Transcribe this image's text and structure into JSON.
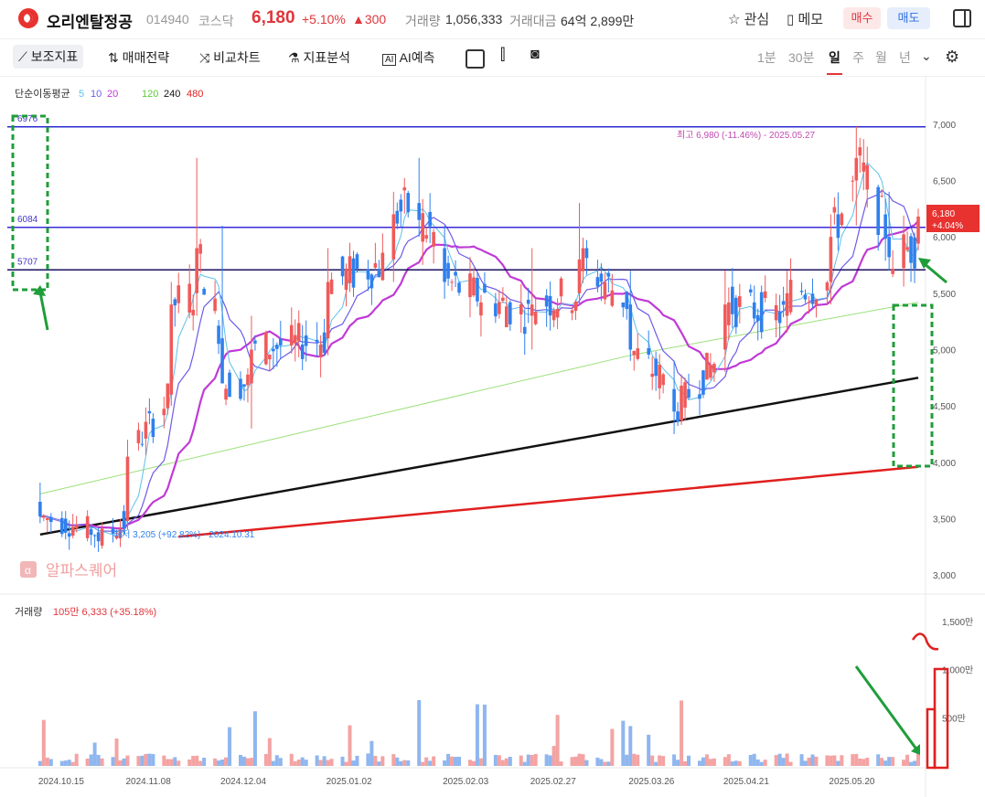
{
  "header": {
    "name": "오리엔탈정공",
    "code": "014940",
    "market": "코스닥",
    "price": "6,180",
    "change_pct": "+5.10%",
    "change_abs": "▲300",
    "volume_label": "거래량",
    "volume": "1,056,333",
    "amount_label": "거래대금",
    "amount": "64억 2,899만",
    "watch_label": "관심",
    "memo_label": "메모",
    "buy_label": "매수",
    "sell_label": "매도"
  },
  "toolbar": {
    "items": [
      "보조지표",
      "매매전략",
      "비교차트",
      "지표분석",
      "AI예측"
    ],
    "periods": [
      "1분",
      "30분",
      "일",
      "주",
      "월",
      "년"
    ],
    "active_period": "일"
  },
  "indicator_legend": {
    "label": "단순이동평균",
    "ma": [
      {
        "v": "5",
        "color": "#5bc0eb"
      },
      {
        "v": "10",
        "color": "#6c5ce7"
      },
      {
        "v": "20",
        "color": "#c03ad6"
      },
      {
        "v": "120",
        "color": "#7ed957"
      },
      {
        "v": "240",
        "color": "#111111"
      },
      {
        "v": "480",
        "color": "#e0201f"
      }
    ]
  },
  "watermark": "알파스퀘어",
  "colors": {
    "up": "#f05a5a",
    "down": "#2f80ed",
    "vol_up": "#f4a3a3",
    "vol_down": "#8fb6ef",
    "annotation": "#1f9d3a"
  },
  "chart_data": {
    "type": "candlestick",
    "x_ticks": [
      "2024.10.15",
      "2024.11.08",
      "2024.12.04",
      "2025.01.02",
      "2025.02.03",
      "2025.02.27",
      "2025.03.26",
      "2025.04.21",
      "2025.05.20"
    ],
    "y_ticks": [
      "3,000",
      "3,500",
      "4,000",
      "4,500",
      "5,000",
      "5,500",
      "6,000",
      "6,500",
      "7,000"
    ],
    "ylim": [
      2880,
      7420
    ],
    "horizontal_lines": [
      {
        "label": "6976",
        "value": 6976,
        "color": "#2b2bd0"
      },
      {
        "label": "6084",
        "value": 6084,
        "color": "#3a2bd8"
      },
      {
        "label": "5707",
        "value": 5707,
        "color": "#1a1060"
      }
    ],
    "high_annotation": "최고 6,980 (-11.46%) - 2025.05.27",
    "low_annotation": "최저 3,205 (+92.82%) - 2024.10.31",
    "last_price": "6,180",
    "last_change": "+4.04%",
    "ohlc_anchors": [
      {
        "x": "2024.10.15",
        "o": 3650,
        "h": 3820,
        "l": 3460,
        "c": 3520
      },
      {
        "x": "2024.10.31",
        "o": 3380,
        "h": 3420,
        "l": 3205,
        "c": 3300
      },
      {
        "x": "2024.11.08",
        "o": 3480,
        "h": 4200,
        "l": 3400,
        "c": 4050
      },
      {
        "x": "2024.11.20",
        "o": 4600,
        "h": 5600,
        "l": 4500,
        "c": 5400
      },
      {
        "x": "2024.11.27",
        "o": 5500,
        "h": 6700,
        "l": 5300,
        "c": 5900
      },
      {
        "x": "2024.12.04",
        "o": 5100,
        "h": 6100,
        "l": 4900,
        "c": 4700
      },
      {
        "x": "2024.12.12",
        "o": 4700,
        "h": 5300,
        "l": 4300,
        "c": 5000
      },
      {
        "x": "2025.01.02",
        "o": 5100,
        "h": 5900,
        "l": 4950,
        "c": 5600
      },
      {
        "x": "2025.01.20",
        "o": 5800,
        "h": 6400,
        "l": 5600,
        "c": 6200
      },
      {
        "x": "2025.01.27",
        "o": 6300,
        "h": 6700,
        "l": 6000,
        "c": 6150
      },
      {
        "x": "2025.02.03",
        "o": 5900,
        "h": 6100,
        "l": 5450,
        "c": 5600
      },
      {
        "x": "2025.02.27",
        "o": 5300,
        "h": 5900,
        "l": 5000,
        "c": 5400
      },
      {
        "x": "2025.03.12",
        "o": 5500,
        "h": 6300,
        "l": 5400,
        "c": 5800
      },
      {
        "x": "2025.03.26",
        "o": 5400,
        "h": 5700,
        "l": 4900,
        "c": 5000
      },
      {
        "x": "2025.04.07",
        "o": 4650,
        "h": 4900,
        "l": 4250,
        "c": 4450
      },
      {
        "x": "2025.04.21",
        "o": 5000,
        "h": 5700,
        "l": 4800,
        "c": 5400
      },
      {
        "x": "2025.05.08",
        "o": 5300,
        "h": 5700,
        "l": 5150,
        "c": 5500
      },
      {
        "x": "2025.05.20",
        "o": 5600,
        "h": 6200,
        "l": 5400,
        "c": 6000
      },
      {
        "x": "2025.05.27",
        "o": 6500,
        "h": 6980,
        "l": 6100,
        "c": 6700
      },
      {
        "x": "2025.06.05",
        "o": 6000,
        "h": 6400,
        "l": 5700,
        "c": 5820
      },
      {
        "x": "2025.06.13",
        "o": 5940,
        "h": 6250,
        "l": 5880,
        "c": 6180
      }
    ],
    "moving_averages": {
      "ma240": [
        {
          "x": "2024.10.15",
          "y": 3360
        },
        {
          "x": "2025.06.13",
          "y": 4750
        }
      ],
      "ma480": [
        {
          "x": "2024.11.22",
          "y": 3340
        },
        {
          "x": "2025.06.13",
          "y": 3960
        }
      ],
      "ma120": [
        {
          "x": "2024.10.15",
          "y": 3720
        },
        {
          "x": "2025.01.02",
          "y": 4320
        },
        {
          "x": "2025.03.26",
          "y": 4950
        },
        {
          "x": "2025.06.13",
          "y": 5420
        }
      ]
    },
    "volume": {
      "label": "거래량",
      "value_label": "105만 6,333 (+35.18%)",
      "y_ticks": [
        "500만",
        "1,000만",
        "1,500만"
      ],
      "ylim": [
        0,
        16500000
      ]
    }
  }
}
